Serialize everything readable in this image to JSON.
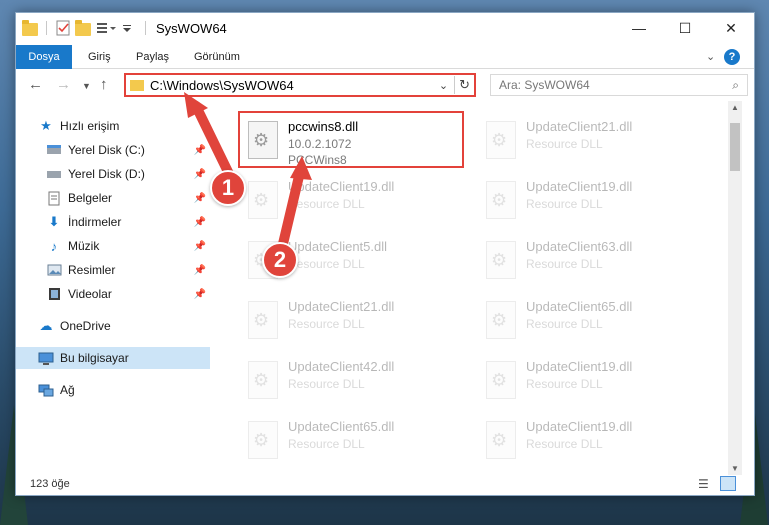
{
  "window": {
    "title": "SysWOW64",
    "minimize_glyph": "—",
    "maximize_glyph": "☐",
    "close_glyph": "✕"
  },
  "ribbon": {
    "tabs": [
      "Dosya",
      "Giriş",
      "Paylaş",
      "Görünüm"
    ],
    "help_glyph": "?"
  },
  "address": {
    "path": "C:\\Windows\\SysWOW64",
    "search_placeholder": "Ara: SysWOW64"
  },
  "sidebar": {
    "quick_access": "Hızlı erişim",
    "items": [
      {
        "label": "Yerel Disk (C:)",
        "icon": "drive-icon",
        "pinned": true
      },
      {
        "label": "Yerel Disk (D:)",
        "icon": "drive-icon",
        "pinned": true
      },
      {
        "label": "Belgeler",
        "icon": "documents-icon",
        "pinned": true
      },
      {
        "label": "İndirmeler",
        "icon": "download-icon",
        "pinned": true
      },
      {
        "label": "Müzik",
        "icon": "music-icon",
        "pinned": true
      },
      {
        "label": "Resimler",
        "icon": "pictures-icon",
        "pinned": true
      },
      {
        "label": "Videolar",
        "icon": "videos-icon",
        "pinned": true
      }
    ],
    "onedrive": "OneDrive",
    "this_pc": "Bu bilgisayar",
    "network": "Ağ"
  },
  "files": {
    "main": {
      "name": "pccwins8.dll",
      "version": "10.0.2.1072",
      "description": "PCCWins8"
    },
    "left_column": [
      {
        "name": "UpdateClient19.dll",
        "type": "Resource DLL"
      },
      {
        "name": "UpdateClient5.dll",
        "type": "Resource DLL"
      },
      {
        "name": "UpdateClient21.dll",
        "type": "Resource DLL"
      },
      {
        "name": "UpdateClient42.dll",
        "type": "Resource DLL"
      },
      {
        "name": "UpdateClient65.dll",
        "type": "Resource DLL"
      }
    ],
    "right_column": [
      {
        "name": "UpdateClient21.dll",
        "type": "Resource DLL"
      },
      {
        "name": "UpdateClient19.dll",
        "type": "Resource DLL"
      },
      {
        "name": "UpdateClient63.dll",
        "type": "Resource DLL"
      },
      {
        "name": "UpdateClient65.dll",
        "type": "Resource DLL"
      },
      {
        "name": "UpdateClient19.dll",
        "type": "Resource DLL"
      },
      {
        "name": "UpdateClient19.dll",
        "type": "Resource DLL"
      }
    ]
  },
  "status": {
    "count": "123 öğe"
  },
  "callouts": {
    "one": "1",
    "two": "2"
  },
  "colors": {
    "accent": "#1979ca",
    "highlight": "#e3423a",
    "selected": "#cce4f7"
  }
}
